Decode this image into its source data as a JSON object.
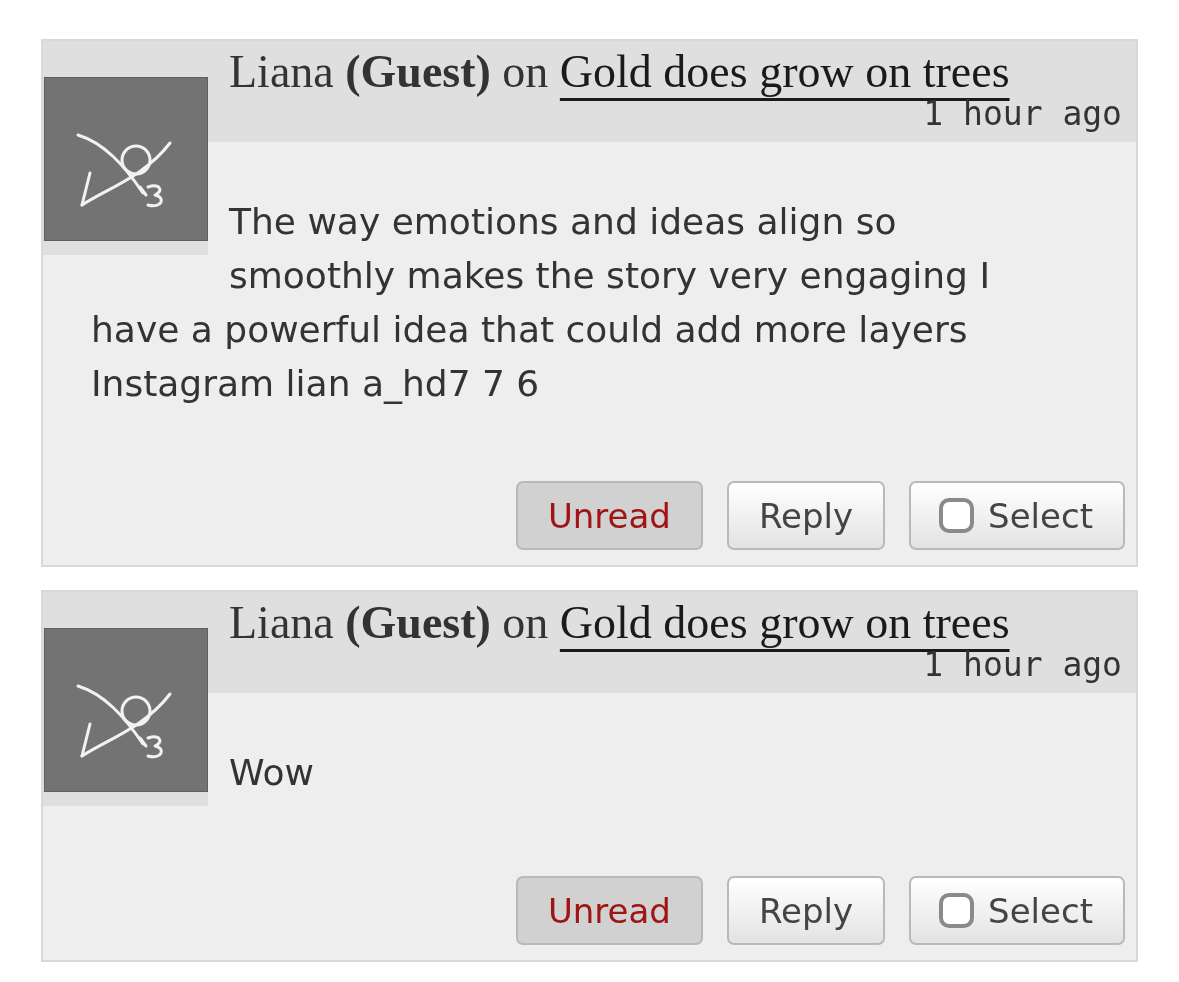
{
  "comments": [
    {
      "byline": "Liana **(Guest)** on",
      "post_link": "Gold does grow on trees",
      "time": "1 hour ago",
      "body": "The way emotions and ideas align so smoothly makes the story very engaging I have a powerful idea that could add more layers Instagram lian a_hd7 7 6",
      "buttons": [
        {
          "label": "Unread",
          "kind": "toggle",
          "active": true
        },
        {
          "label": "Reply",
          "kind": "plain"
        },
        {
          "label": "Select",
          "kind": "checkbox",
          "checked": false
        }
      ]
    },
    {
      "byline": "Liana **(Guest)** on",
      "post_link": "Gold does grow on trees",
      "time": "1 hour ago",
      "body": "Wow",
      "buttons": [
        {
          "label": "Unread",
          "kind": "toggle",
          "active": true
        },
        {
          "label": "Reply",
          "kind": "plain"
        },
        {
          "label": "Select",
          "kind": "checkbox",
          "checked": false
        }
      ]
    }
  ]
}
